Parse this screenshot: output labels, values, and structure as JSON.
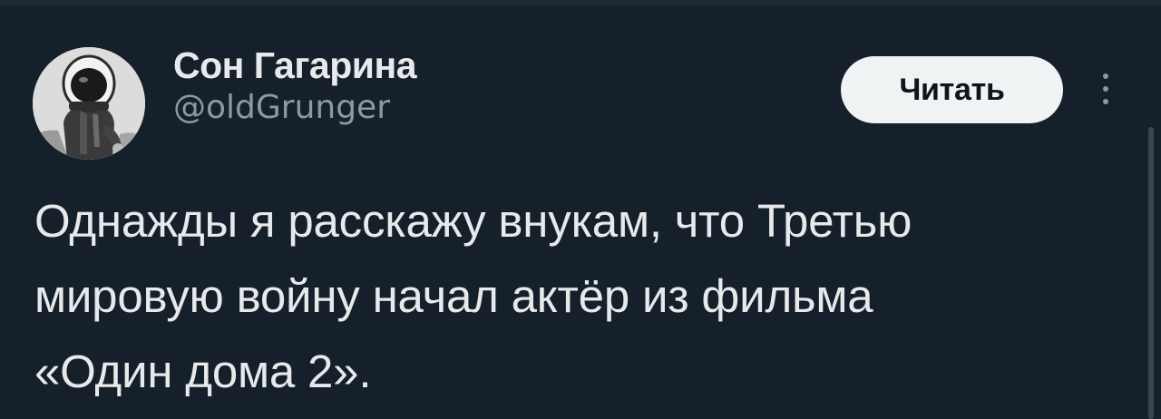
{
  "tweet": {
    "author": {
      "display_name": "Сон Гагарина",
      "handle": "@oldGrunger",
      "avatar_icon": "astronaut-avatar-icon"
    },
    "follow_button_label": "Читать",
    "more_icon": "more-vertical-icon",
    "text_lines": [
      "Однажды я расскажу внукам, что Третью",
      "мировую войну начал актёр из фильма",
      "«Один дома 2»."
    ]
  },
  "colors": {
    "background": "#15202b",
    "text_primary": "#e7e9ea",
    "text_secondary": "#8b98a5",
    "button_background": "#eff3f4",
    "button_text": "#0f1419"
  }
}
